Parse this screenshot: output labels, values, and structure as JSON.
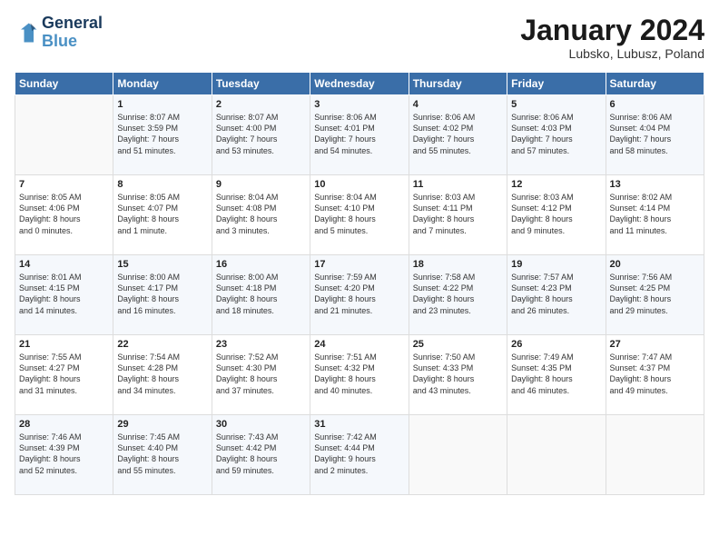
{
  "header": {
    "logo_line1": "General",
    "logo_line2": "Blue",
    "month": "January 2024",
    "location": "Lubsko, Lubusz, Poland"
  },
  "weekdays": [
    "Sunday",
    "Monday",
    "Tuesday",
    "Wednesday",
    "Thursday",
    "Friday",
    "Saturday"
  ],
  "weeks": [
    [
      {
        "day": "",
        "info": ""
      },
      {
        "day": "1",
        "info": "Sunrise: 8:07 AM\nSunset: 3:59 PM\nDaylight: 7 hours\nand 51 minutes."
      },
      {
        "day": "2",
        "info": "Sunrise: 8:07 AM\nSunset: 4:00 PM\nDaylight: 7 hours\nand 53 minutes."
      },
      {
        "day": "3",
        "info": "Sunrise: 8:06 AM\nSunset: 4:01 PM\nDaylight: 7 hours\nand 54 minutes."
      },
      {
        "day": "4",
        "info": "Sunrise: 8:06 AM\nSunset: 4:02 PM\nDaylight: 7 hours\nand 55 minutes."
      },
      {
        "day": "5",
        "info": "Sunrise: 8:06 AM\nSunset: 4:03 PM\nDaylight: 7 hours\nand 57 minutes."
      },
      {
        "day": "6",
        "info": "Sunrise: 8:06 AM\nSunset: 4:04 PM\nDaylight: 7 hours\nand 58 minutes."
      }
    ],
    [
      {
        "day": "7",
        "info": "Sunrise: 8:05 AM\nSunset: 4:06 PM\nDaylight: 8 hours\nand 0 minutes."
      },
      {
        "day": "8",
        "info": "Sunrise: 8:05 AM\nSunset: 4:07 PM\nDaylight: 8 hours\nand 1 minute."
      },
      {
        "day": "9",
        "info": "Sunrise: 8:04 AM\nSunset: 4:08 PM\nDaylight: 8 hours\nand 3 minutes."
      },
      {
        "day": "10",
        "info": "Sunrise: 8:04 AM\nSunset: 4:10 PM\nDaylight: 8 hours\nand 5 minutes."
      },
      {
        "day": "11",
        "info": "Sunrise: 8:03 AM\nSunset: 4:11 PM\nDaylight: 8 hours\nand 7 minutes."
      },
      {
        "day": "12",
        "info": "Sunrise: 8:03 AM\nSunset: 4:12 PM\nDaylight: 8 hours\nand 9 minutes."
      },
      {
        "day": "13",
        "info": "Sunrise: 8:02 AM\nSunset: 4:14 PM\nDaylight: 8 hours\nand 11 minutes."
      }
    ],
    [
      {
        "day": "14",
        "info": "Sunrise: 8:01 AM\nSunset: 4:15 PM\nDaylight: 8 hours\nand 14 minutes."
      },
      {
        "day": "15",
        "info": "Sunrise: 8:00 AM\nSunset: 4:17 PM\nDaylight: 8 hours\nand 16 minutes."
      },
      {
        "day": "16",
        "info": "Sunrise: 8:00 AM\nSunset: 4:18 PM\nDaylight: 8 hours\nand 18 minutes."
      },
      {
        "day": "17",
        "info": "Sunrise: 7:59 AM\nSunset: 4:20 PM\nDaylight: 8 hours\nand 21 minutes."
      },
      {
        "day": "18",
        "info": "Sunrise: 7:58 AM\nSunset: 4:22 PM\nDaylight: 8 hours\nand 23 minutes."
      },
      {
        "day": "19",
        "info": "Sunrise: 7:57 AM\nSunset: 4:23 PM\nDaylight: 8 hours\nand 26 minutes."
      },
      {
        "day": "20",
        "info": "Sunrise: 7:56 AM\nSunset: 4:25 PM\nDaylight: 8 hours\nand 29 minutes."
      }
    ],
    [
      {
        "day": "21",
        "info": "Sunrise: 7:55 AM\nSunset: 4:27 PM\nDaylight: 8 hours\nand 31 minutes."
      },
      {
        "day": "22",
        "info": "Sunrise: 7:54 AM\nSunset: 4:28 PM\nDaylight: 8 hours\nand 34 minutes."
      },
      {
        "day": "23",
        "info": "Sunrise: 7:52 AM\nSunset: 4:30 PM\nDaylight: 8 hours\nand 37 minutes."
      },
      {
        "day": "24",
        "info": "Sunrise: 7:51 AM\nSunset: 4:32 PM\nDaylight: 8 hours\nand 40 minutes."
      },
      {
        "day": "25",
        "info": "Sunrise: 7:50 AM\nSunset: 4:33 PM\nDaylight: 8 hours\nand 43 minutes."
      },
      {
        "day": "26",
        "info": "Sunrise: 7:49 AM\nSunset: 4:35 PM\nDaylight: 8 hours\nand 46 minutes."
      },
      {
        "day": "27",
        "info": "Sunrise: 7:47 AM\nSunset: 4:37 PM\nDaylight: 8 hours\nand 49 minutes."
      }
    ],
    [
      {
        "day": "28",
        "info": "Sunrise: 7:46 AM\nSunset: 4:39 PM\nDaylight: 8 hours\nand 52 minutes."
      },
      {
        "day": "29",
        "info": "Sunrise: 7:45 AM\nSunset: 4:40 PM\nDaylight: 8 hours\nand 55 minutes."
      },
      {
        "day": "30",
        "info": "Sunrise: 7:43 AM\nSunset: 4:42 PM\nDaylight: 8 hours\nand 59 minutes."
      },
      {
        "day": "31",
        "info": "Sunrise: 7:42 AM\nSunset: 4:44 PM\nDaylight: 9 hours\nand 2 minutes."
      },
      {
        "day": "",
        "info": ""
      },
      {
        "day": "",
        "info": ""
      },
      {
        "day": "",
        "info": ""
      }
    ]
  ]
}
